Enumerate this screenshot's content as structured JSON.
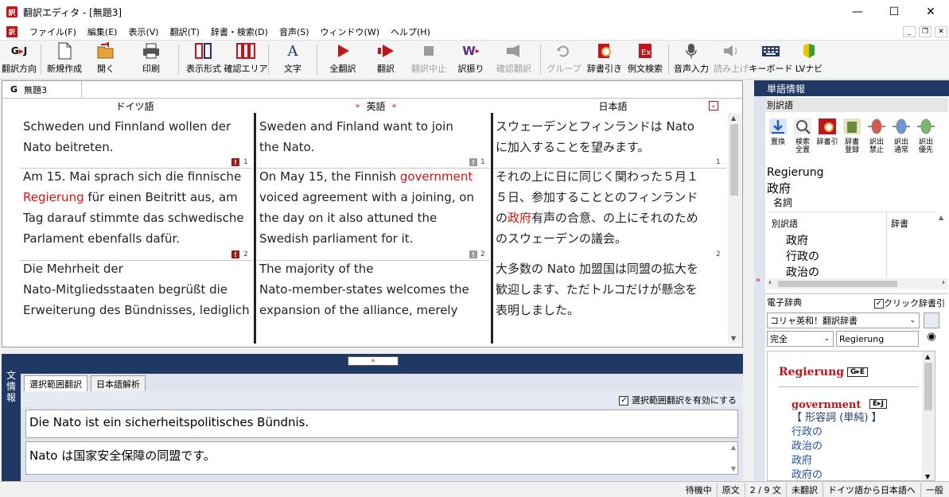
{
  "window": {
    "title": "翻訳エディタ - [無題3]"
  },
  "menu": [
    "ファイル(F)",
    "編集(E)",
    "表示(V)",
    "翻訳(T)",
    "辞書・検索(D)",
    "音声(S)",
    "ウィンドウ(W)",
    "ヘルプ(H)"
  ],
  "toolbar": [
    {
      "label": "翻訳方向",
      "icon": "translation-direction-icon",
      "enabled": true
    },
    {
      "label": "新規作成",
      "icon": "new-document-icon",
      "enabled": true
    },
    {
      "label": "開く",
      "icon": "open-folder-icon",
      "enabled": true
    },
    {
      "label": "印刷",
      "icon": "printer-icon",
      "enabled": true
    },
    {
      "label": "表示形式",
      "icon": "display-format-icon",
      "enabled": true
    },
    {
      "label": "確認エリア",
      "icon": "check-area-icon",
      "enabled": true
    },
    {
      "label": "文字",
      "icon": "font-icon",
      "enabled": true
    },
    {
      "label": "全翻訳",
      "icon": "translate-all-icon",
      "enabled": true
    },
    {
      "label": "翻訳",
      "icon": "translate-icon",
      "enabled": true
    },
    {
      "label": "翻訳中止",
      "icon": "stop-icon",
      "enabled": false
    },
    {
      "label": "訳振り",
      "icon": "ruby-translation-icon",
      "enabled": true
    },
    {
      "label": "確認翻訳",
      "icon": "confirm-translation-icon",
      "enabled": false
    },
    {
      "label": "グループ",
      "icon": "group-icon",
      "enabled": false
    },
    {
      "label": "辞書引き",
      "icon": "dictionary-lookup-icon",
      "enabled": true
    },
    {
      "label": "例文検索",
      "icon": "example-search-icon",
      "enabled": true
    },
    {
      "label": "音声入力",
      "icon": "microphone-icon",
      "enabled": true
    },
    {
      "label": "読み上げ",
      "icon": "speaker-icon",
      "enabled": false
    },
    {
      "label": "キーボード",
      "icon": "keyboard-icon",
      "enabled": true
    },
    {
      "label": "LVナビ",
      "icon": "lv-navi-icon",
      "enabled": true
    }
  ],
  "editor": {
    "tab_label": "無題3",
    "tab_prefix": "G",
    "columns": {
      "german": "ドイツ語",
      "english": "英語",
      "japanese": "日本語"
    },
    "segments": [
      {
        "num": "1",
        "de": [
          "Schweden und Finnland wollen der",
          "Nato beitreten."
        ],
        "en": [
          "Sweden and Finland want to join",
          "the Nato."
        ],
        "ja": [
          "スウェーデンとフィンランドは Nato",
          "に加入することを望みます。"
        ]
      },
      {
        "num": "2",
        "de_pre": "Am 15. Mai sprach sich die finnische",
        "de_red": "Regierung",
        "de_post": " für einen Beitritt aus, am",
        "de_rest": [
          "Tag darauf stimmte das schwedische",
          "Parlament ebenfalls dafür."
        ],
        "en_pre": "On May 15, the Finnish ",
        "en_red": "government",
        "en_rest": [
          "voiced agreement with a joining, on",
          "the day on it also attuned the",
          "Swedish parliament for it."
        ],
        "ja_l1": "それの上に日に同じく関わった５月１",
        "ja_l2": "５日、参加することとのフィンランド",
        "ja_pre": "の",
        "ja_red": "政府",
        "ja_post": "有声の合意、の上にそれのため",
        "ja_l4": "のスウェーデンの議会。"
      },
      {
        "num": "3",
        "de": [
          "Die Mehrheit der",
          "Nato-Mitgliedsstaaten begrüßt die",
          "Erweiterung des Bündnisses, lediglich"
        ],
        "en": [
          "The majority of the",
          "Nato-member-states welcomes the",
          "expansion of the alliance, merely"
        ],
        "ja": [
          "大多数の Nato 加盟国は同盟の拡大を",
          "歓迎します、ただトルコだけが懸念を",
          "表明しました。"
        ]
      }
    ]
  },
  "bottom": {
    "side_label": [
      "文",
      "情",
      "報"
    ],
    "tabs": [
      "選択範囲翻訳",
      "日本語解析"
    ],
    "checkbox_label": "選択範囲翻訳を有効にする",
    "source": "Die Nato ist ein sicherheitspolitisches Bündnis.",
    "target": "Nato は国家安全保障の同盟です。"
  },
  "word_info": {
    "header": "単語情報",
    "alt_header": "別訳語",
    "buttons": [
      {
        "label1": "置換",
        "label2": "",
        "icon": "replace-icon"
      },
      {
        "label1": "検索",
        "label2": "全置",
        "icon": "search-replace-icon"
      },
      {
        "label1": "辞書引",
        "label2": "",
        "icon": "dictionary-icon"
      },
      {
        "label1": "辞書",
        "label2": "登録",
        "icon": "dictionary-register-icon"
      },
      {
        "label1": "訳出",
        "label2": "禁止",
        "icon": "slider-forbid-icon"
      },
      {
        "label1": "訳出",
        "label2": "通常",
        "icon": "slider-normal-icon"
      },
      {
        "label1": "訳出",
        "label2": "優先",
        "icon": "slider-priority-icon"
      }
    ],
    "word": "Regierung",
    "translation": "政府",
    "pos": "名詞",
    "list_headers": [
      "別訳語",
      "辞書"
    ],
    "list_items": [
      "政府",
      "行政の",
      "政治の"
    ]
  },
  "edict": {
    "header": "電子辞典",
    "click_lookup": "クリック辞書引",
    "dictionary": "コリャ英和！翻訳辞書",
    "match": "完全",
    "query": "Regierung",
    "entry_word": "Regierung",
    "entry_tag": "G▸E",
    "sub_word": "government",
    "sub_tag": "E▸J",
    "pos": "【 形容詞 (単純) 】",
    "meanings": [
      "行政の",
      "政治の",
      "政府",
      "政府の"
    ]
  },
  "status": [
    "待機中",
    "原文",
    "2 / 9 文",
    "未翻訳",
    "ドイツ語から日本語へ",
    "一般"
  ]
}
